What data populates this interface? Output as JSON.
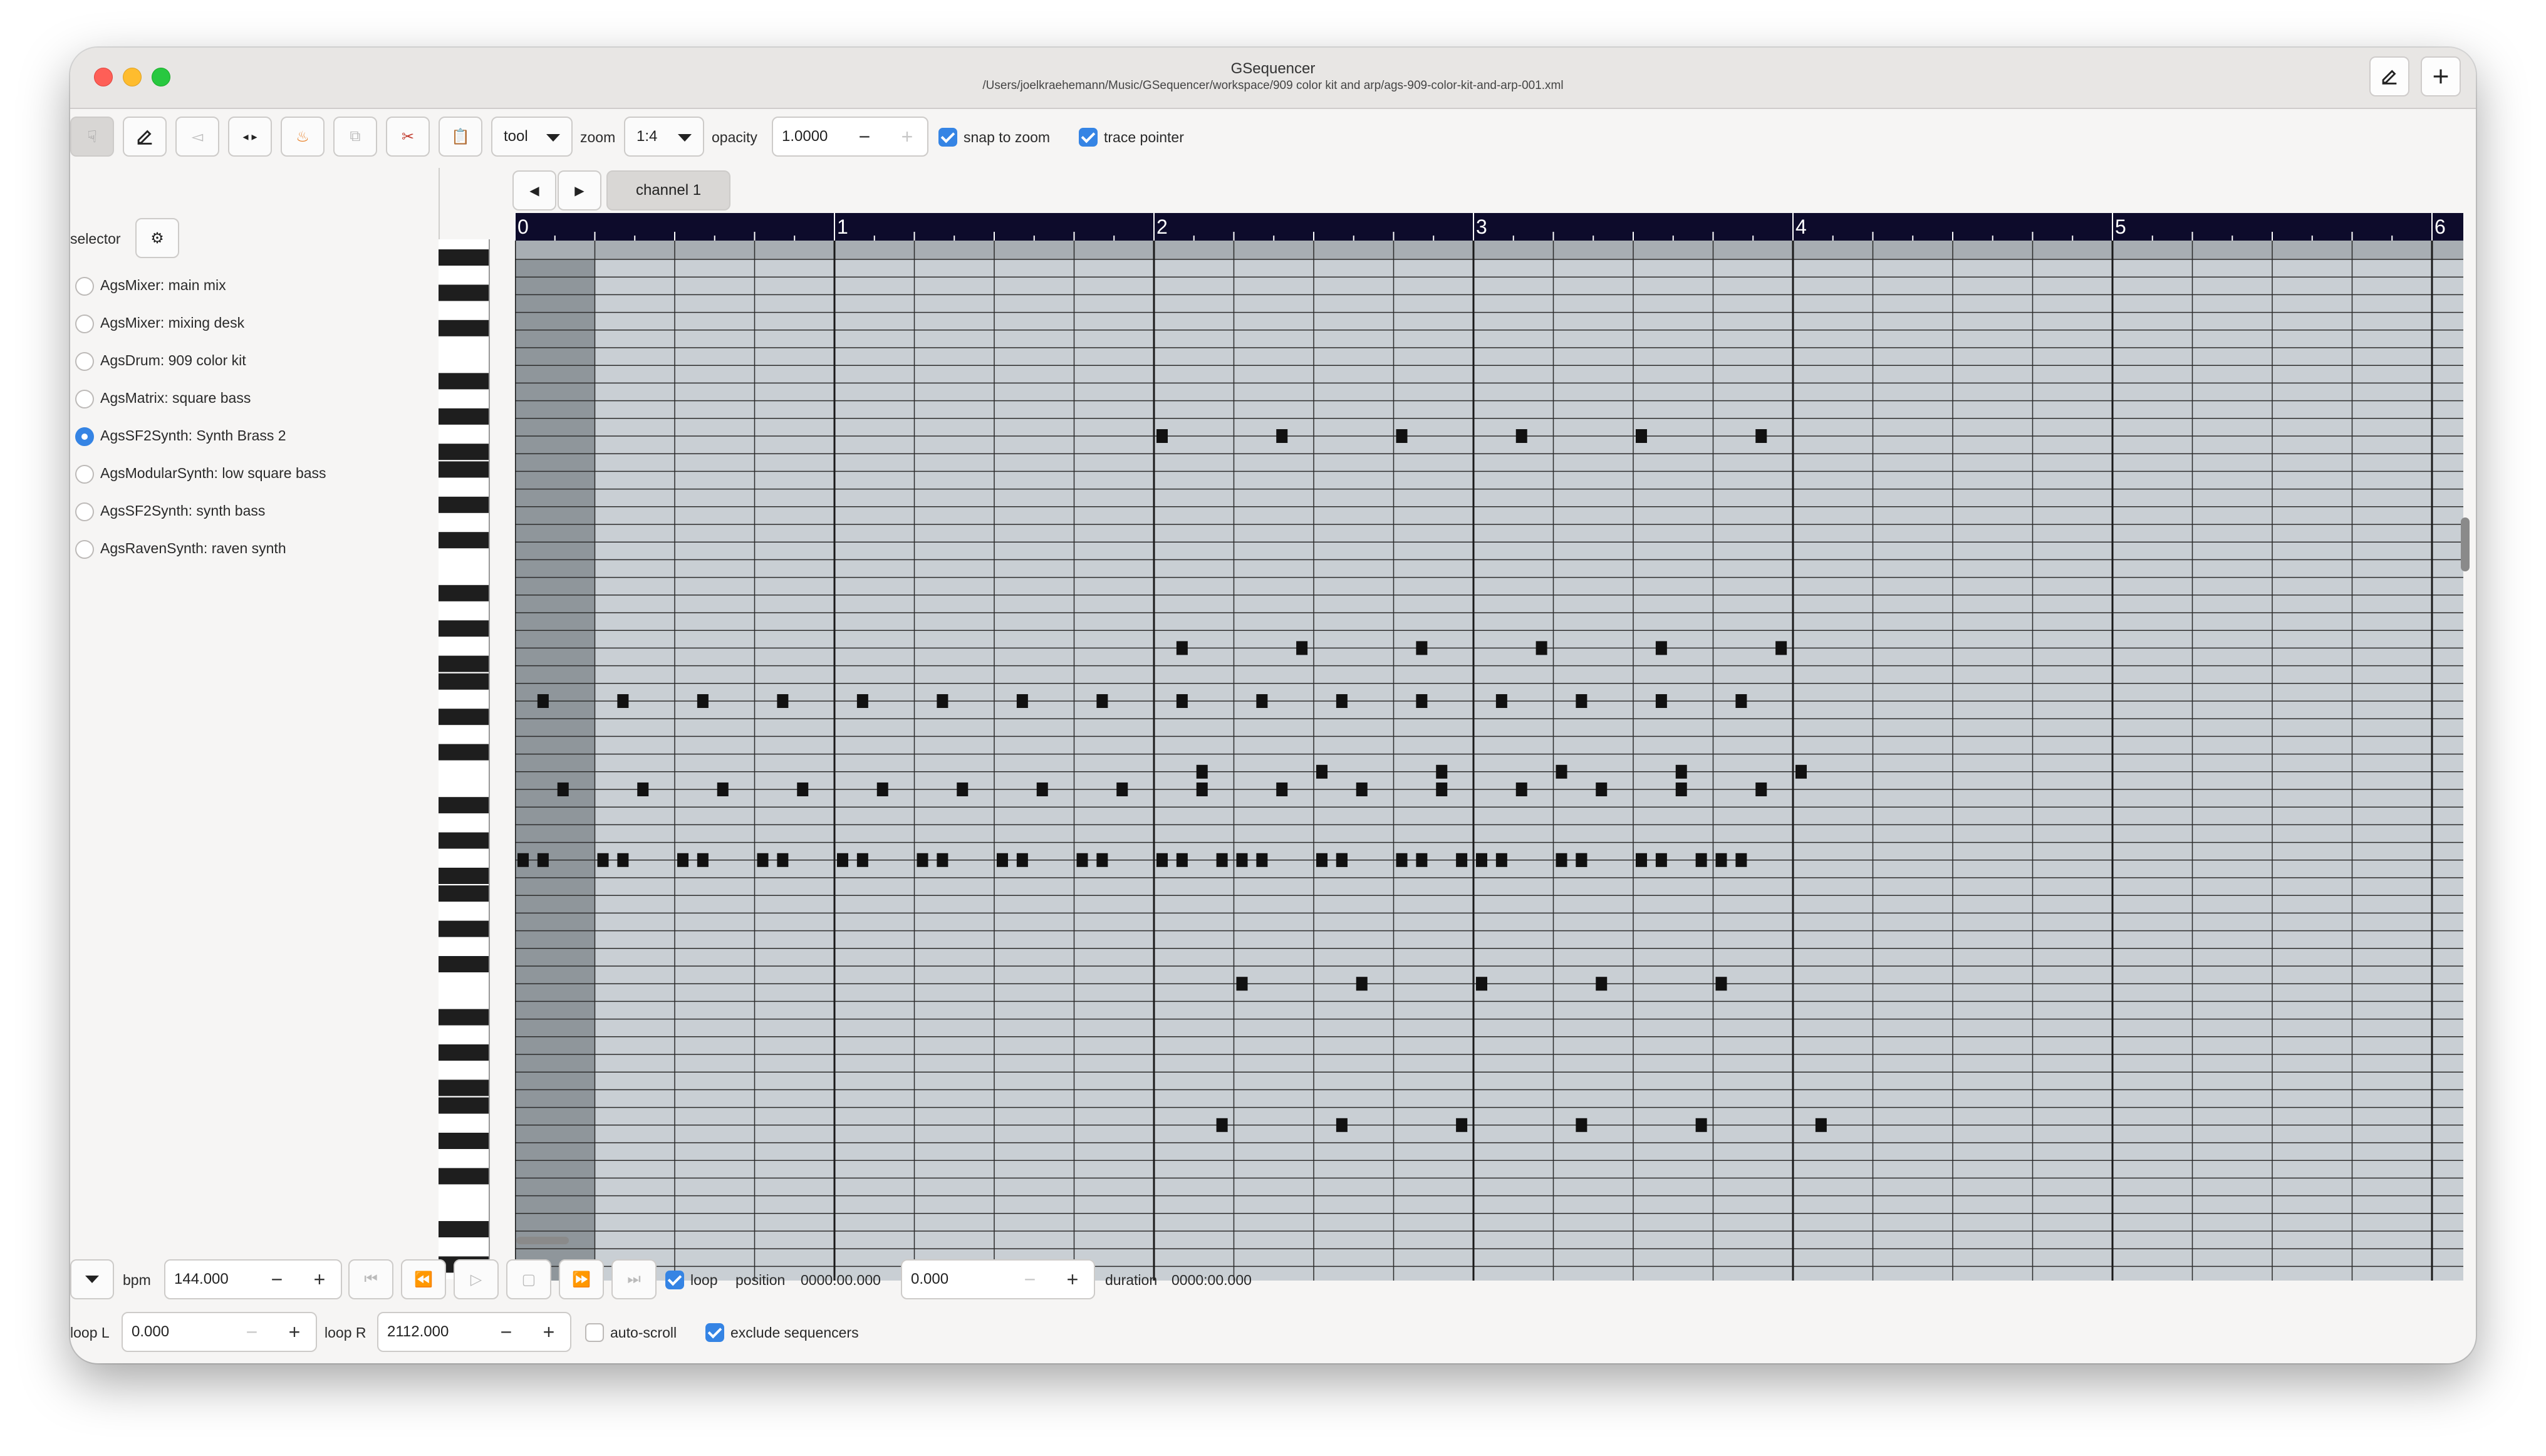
{
  "window": {
    "title": "GSequencer",
    "subtitle": "/Users/joelkraehemann/Music/GSequencer/workspace/909 color kit and arp/ags-909-color-kit-and-arp-001.xml"
  },
  "toolbar": {
    "tool_label": "tool",
    "zoom_label": "zoom",
    "zoom_value": "1:4",
    "opacity_label": "opacity",
    "opacity_value": "1.0000",
    "snap_to_zoom_label": "snap to zoom",
    "snap_to_zoom_checked": true,
    "trace_pointer_label": "trace pointer",
    "trace_pointer_checked": true
  },
  "selector": {
    "label": "selector",
    "items": [
      {
        "label": "AgsMixer: main mix",
        "selected": false
      },
      {
        "label": "AgsMixer: mixing desk",
        "selected": false
      },
      {
        "label": "AgsDrum: 909 color kit",
        "selected": false
      },
      {
        "label": "AgsMatrix: square bass",
        "selected": false
      },
      {
        "label": "AgsSF2Synth: Synth Brass 2",
        "selected": true
      },
      {
        "label": "AgsModularSynth: low square bass",
        "selected": false
      },
      {
        "label": "AgsSF2Synth: synth bass",
        "selected": false
      },
      {
        "label": "AgsRavenSynth: raven synth",
        "selected": false
      }
    ]
  },
  "tabs": {
    "channel_label": "channel 1"
  },
  "ruler": {
    "labels": [
      "0",
      "1",
      "2",
      "3",
      "4",
      "5",
      "6"
    ]
  },
  "transport": {
    "bpm_label": "bpm",
    "bpm_value": "144.000",
    "loop_label": "loop",
    "loop_checked": true,
    "position_label": "position",
    "position_time": "0000:00.000",
    "position_value": "0.000",
    "duration_label": "duration",
    "duration_time": "0000:00.000",
    "loop_l_label": "loop L",
    "loop_l_value": "0.000",
    "loop_r_label": "loop R",
    "loop_r_value": "2112.000",
    "auto_scroll_label": "auto-scroll",
    "auto_scroll_checked": false,
    "exclude_sequencers_label": "exclude sequencers",
    "exclude_sequencers_checked": true
  },
  "colors": {
    "accent": "#3584e4",
    "ruler_bg": "#0d0b2b",
    "grid_bg": "#c9cfd4",
    "note": "#111111"
  },
  "notes": {
    "tick_unit": "1/4 bar",
    "rows": [
      {
        "row": 10,
        "ticks": [
          16,
          19,
          22,
          25,
          28,
          31
        ]
      },
      {
        "row": 22,
        "ticks": [
          16.5,
          19.5,
          22.5,
          25.5,
          28.5,
          31.5
        ]
      },
      {
        "row": 25,
        "ticks": [
          0.5,
          2.5,
          4.5,
          6.5,
          8.5,
          10.5,
          12.5,
          14.5,
          16.5,
          18.5,
          20.5,
          22.5,
          24.5,
          26.5,
          28.5,
          30.5
        ]
      },
      {
        "row": 29,
        "ticks": [
          17,
          20,
          23,
          26,
          29,
          32
        ]
      },
      {
        "row": 30,
        "ticks": [
          1,
          3,
          5,
          7,
          9,
          11,
          13,
          15,
          17,
          19,
          21,
          23,
          25,
          27,
          29,
          31
        ]
      },
      {
        "row": 34,
        "ticks": [
          0,
          0.5,
          2,
          2.5,
          4,
          4.5,
          6,
          6.5,
          8,
          8.5,
          10,
          10.5,
          12,
          12.5,
          14,
          14.5,
          16,
          16.5,
          18,
          18.5,
          20,
          20.5,
          22,
          22.5,
          24,
          24.5,
          26,
          26.5,
          28,
          28.5,
          30,
          30.5,
          17.5,
          20.5,
          23.5,
          26.5,
          29.5
        ]
      },
      {
        "row": 41,
        "ticks": [
          18,
          21,
          24,
          27,
          30
        ]
      },
      {
        "row": 49,
        "ticks": [
          17.5,
          20.5,
          23.5,
          26.5,
          29.5,
          32.5
        ]
      }
    ]
  }
}
